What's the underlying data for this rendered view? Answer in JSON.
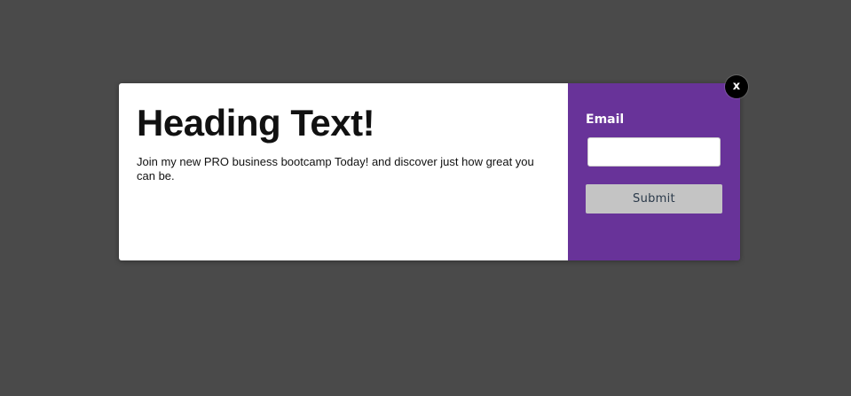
{
  "popup": {
    "heading": "Heading Text!",
    "body": "Join my new PRO business bootcamp Today! and discover just how great you can be.",
    "form": {
      "email_label": "Email",
      "email_value": "",
      "email_placeholder": "",
      "submit_label": "Submit"
    },
    "close_label": "x"
  },
  "colors": {
    "backdrop": "#4a4a4a",
    "panel": "#ffffff",
    "accent_purple": "#683399",
    "submit_bg": "#c4c4c4",
    "submit_text": "#2b3a4a",
    "close_bg": "#000000"
  }
}
